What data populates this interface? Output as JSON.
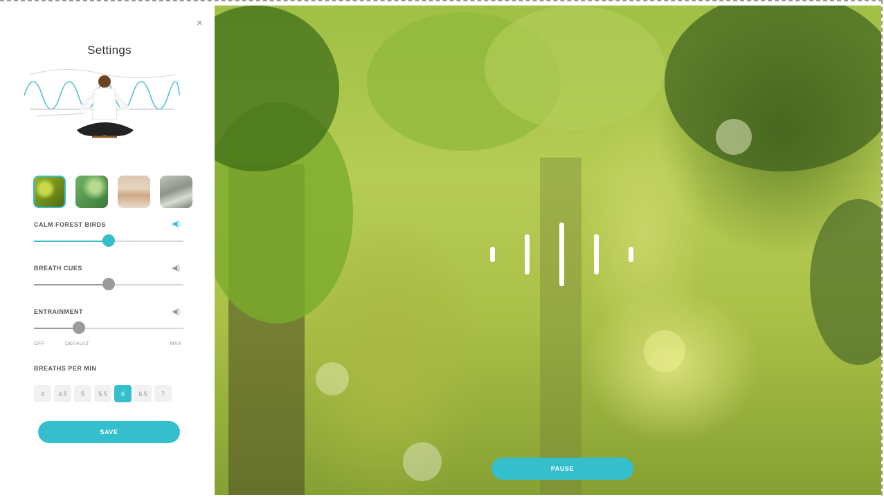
{
  "panel": {
    "close_glyph": "×",
    "title": "Settings",
    "scenes": [
      {
        "name": "forest-leaves",
        "selected": true
      },
      {
        "name": "green-leaves",
        "selected": false
      },
      {
        "name": "beach-sunset",
        "selected": false
      },
      {
        "name": "misty-river",
        "selected": false
      }
    ],
    "sliders": [
      {
        "label": "CALM FOREST BIRDS",
        "value": 0.5,
        "active": true,
        "icon": "volume-icon"
      },
      {
        "label": "BREATH CUES",
        "value": 0.5,
        "active": false,
        "icon": "volume-icon"
      },
      {
        "label": "ENTRAINMENT",
        "value": 0.3,
        "active": false,
        "icon": "volume-icon"
      }
    ],
    "entrainment_scale": {
      "min": "OFF",
      "default": "DEFAULT",
      "max": "MAX"
    },
    "bpm_label": "BREATHS PER MIN",
    "bpm_options": [
      "4",
      "4.5",
      "5",
      "5.5",
      "6",
      "6.5",
      "7"
    ],
    "bpm_selected": "6",
    "save_label": "SAVE"
  },
  "scene": {
    "pause_label": "PAUSE"
  },
  "colors": {
    "accent": "#35bfcc",
    "muted": "#9b9b9b"
  }
}
